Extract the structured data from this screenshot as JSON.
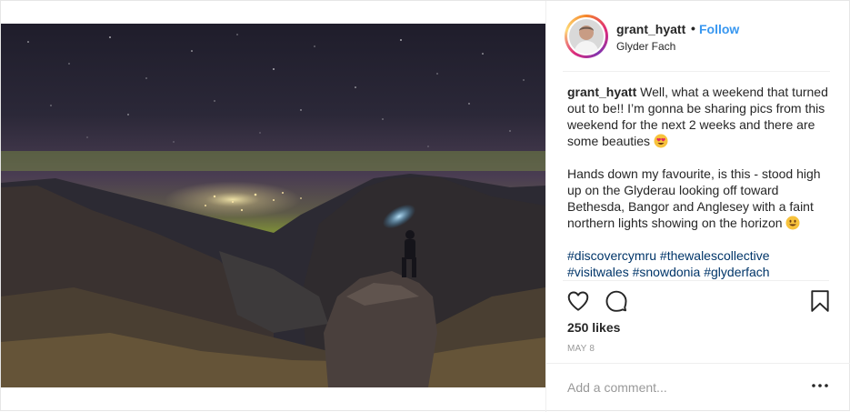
{
  "post": {
    "username": "grant_hyatt",
    "separator": "•",
    "follow_label": "Follow",
    "location": "Glyder Fach",
    "caption": {
      "username": "grant_hyatt",
      "para1": " Well, what a weekend that turned out to be!! I’m gonna be sharing pics from this weekend for the next 2 weeks and there are some beauties ",
      "para2": "Hands down my favourite, is this - stood high up on the Glyderau looking off toward Bethesda, Bangor and Anglesey with a faint northern lights showing on the horizon ",
      "hashtags": [
        "#discovercymru",
        "#thewalescollective",
        "#visitwales",
        "#snowdonia",
        "#glyderfach"
      ],
      "emoji1": "heart-eyes-emoji",
      "emoji2": "smiley-emoji"
    },
    "likes": "250 likes",
    "date": "MAY 8",
    "comment_placeholder": "Add a comment...",
    "icons": {
      "like": "heart-icon",
      "comment": "speech-bubble-icon",
      "save": "bookmark-icon",
      "more": "more-options-icon"
    },
    "colors": {
      "link": "#3897f0",
      "hashtag": "#003569",
      "muted": "#999999",
      "text": "#262626",
      "border": "#efefef"
    }
  }
}
